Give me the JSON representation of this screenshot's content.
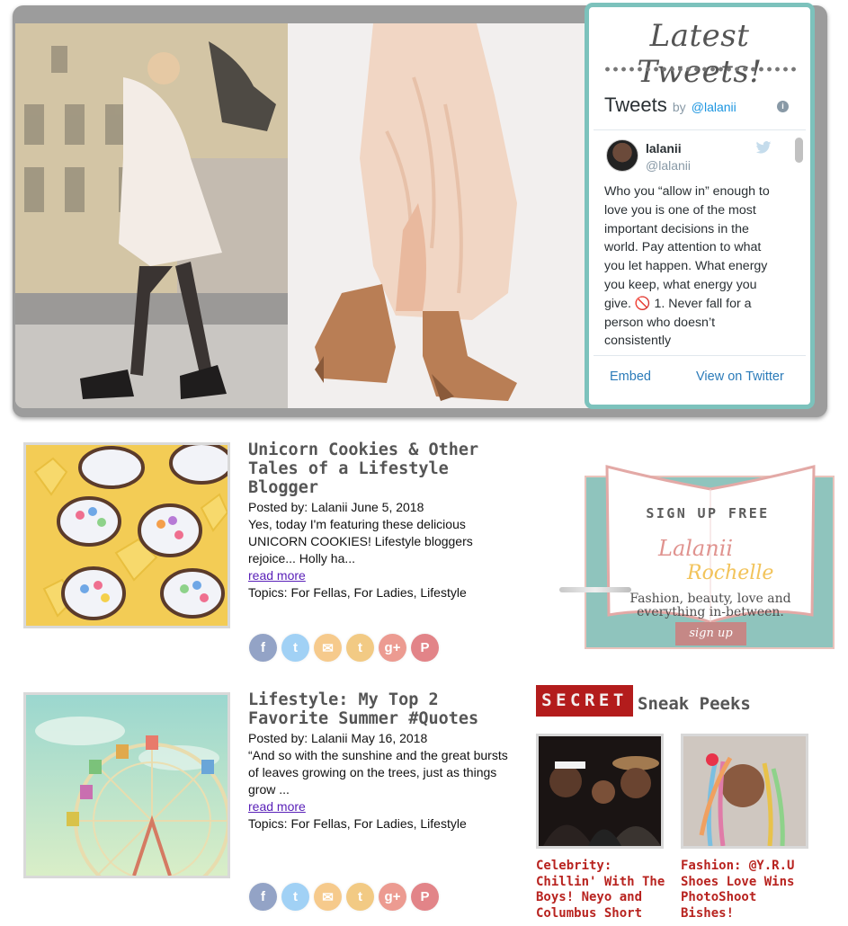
{
  "twitter": {
    "heading": "Latest Tweets!",
    "title": "Tweets",
    "by": "by",
    "handle_link": "@lalanii",
    "tweet": {
      "name": "lalanii",
      "username": "@lalanii",
      "text": "Who you “allow in” enough to love you is one of the most important decisions in the world. Pay attention to what you let happen. What energy you keep, what energy you give. 🚫 1. Never fall for a person who doesn’t consistently"
    },
    "embed_label": "Embed",
    "view_label": "View on Twitter"
  },
  "posts": [
    {
      "title": "Unicorn Cookies & Other Tales of a Lifestyle Blogger",
      "byline": "Posted by: Lalanii June 5, 2018",
      "excerpt": "Yes, today I'm featuring these delicious UNICORN COOKIES! Lifestyle bloggers rejoice... Holly ha...",
      "read_more": "read more",
      "topics": "Topics: For Fellas,  For Ladies,  Lifestyle"
    },
    {
      "title": "Lifestyle: My Top 2 Favorite Summer #Quotes",
      "byline": "Posted by: Lalanii May 16, 2018",
      "excerpt": "“And so with the sunshine and the great bursts of leaves growing on the trees, just as things grow ...",
      "read_more": "read more",
      "topics": "Topics: For Fellas,  For Ladies,  Lifestyle"
    }
  ],
  "social": {
    "facebook": "f",
    "twitter": "t",
    "email": "✉",
    "tumblr": "t",
    "googleplus": "g+",
    "pinterest": "P",
    "colors": [
      "#3b5998",
      "#55acee",
      "#f0a030",
      "#e8a020",
      "#dd4b39",
      "#cb2027"
    ]
  },
  "signup": {
    "heading": "SIGN UP FREE",
    "logo_line1": "Lalanii",
    "logo_line2": "Rochelle",
    "tagline_1": "Fashion, beauty, love and",
    "tagline_2": "everything in-between.",
    "button": "sign up"
  },
  "secret": {
    "badge": "SECRET",
    "title": "Sneak Peeks",
    "items": [
      {
        "caption": "Celebrity: Chillin' With The Boys! Neyo and Columbus Short"
      },
      {
        "caption": "Fashion: @Y.R.U Shoes Love Wins PhotoShoot Bishes!"
      }
    ]
  },
  "colors": {
    "widget_border": "#7cc2bc",
    "tweet_link": "#2b7bb9",
    "post_link": "#5a21b8",
    "secret_red": "#b31c1c",
    "caption_red": "#b8231f",
    "signup_teal": "#8fc4bd"
  }
}
